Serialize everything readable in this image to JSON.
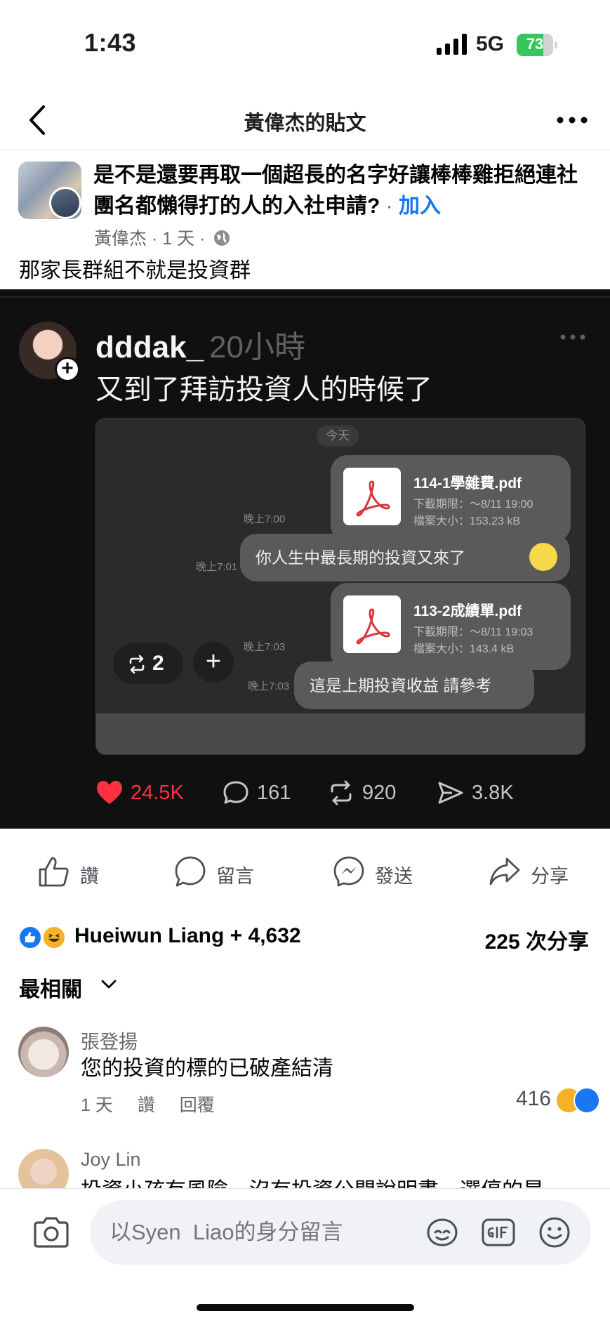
{
  "status": {
    "time": "1:43",
    "network": "5G",
    "battery": "73",
    "battery_level": 0.73
  },
  "nav": {
    "title": "黃偉杰的貼文"
  },
  "post": {
    "group_name": "是不是還要再取一個超長的名字好讓棒棒雞拒絕連社團名都懶得打的人的入社申請?",
    "join_sep": "·",
    "join_label": "加入",
    "author": "黃偉杰",
    "meta_sep": "·",
    "time": "1 天",
    "text": "那家長群組不就是投資群"
  },
  "thread": {
    "username": "dddak_",
    "time": "20小時",
    "text": "又到了拜訪投資人的時候了",
    "screenshot": {
      "date": "今天",
      "files": [
        {
          "name": "114-1學雜費.pdf",
          "expiry": "下載期限：～8/11 19:00",
          "size": "檔案大小：153.23 kB",
          "stamp": "晚上7:00"
        },
        {
          "name": "113-2成績單.pdf",
          "expiry": "下載期限：～8/11 19:03",
          "size": "檔案大小：143.4 kB",
          "stamp": "晚上7:03"
        }
      ],
      "msg1": {
        "text": "你人生中最長期的投資又來了",
        "stamp": "晚上7:01"
      },
      "msg2": {
        "text": "這是上期投資收益 請參考",
        "stamp": "晚上7:03"
      },
      "repost_count": "2",
      "add": "+"
    },
    "stats": {
      "likes": "24.5K",
      "comments": "161",
      "reposts": "920",
      "shares": "3.8K"
    }
  },
  "actions": {
    "like": "讚",
    "comment": "留言",
    "send": "發送",
    "share": "分享"
  },
  "reactions": {
    "names": "Hueiwun Liang + 4,632",
    "shares": "225 次分享"
  },
  "sort": {
    "label": "最相關"
  },
  "comments": [
    {
      "name": "張登揚",
      "text": "您的投資的標的已破產結清",
      "time": "1 天",
      "like": "讚",
      "reply": "回覆",
      "count": "416"
    },
    {
      "name": "Joy Lin",
      "text": "投資小孩有風險，沒有投資公開說明書，選停的是"
    }
  ],
  "composer": {
    "placeholder": "以Syen  Liao的身分留言"
  }
}
